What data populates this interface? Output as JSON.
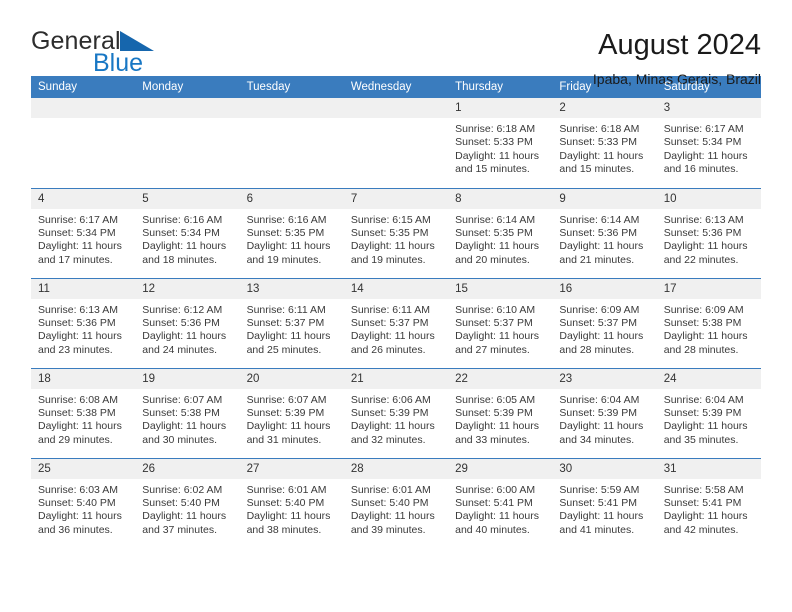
{
  "brand": {
    "name_part1": "General",
    "name_part2": "Blue",
    "accent_color": "#1877c4",
    "triangle_color": "#1666ad"
  },
  "header": {
    "title": "August 2024",
    "subtitle": "Ipaba, Minas Gerais, Brazil"
  },
  "calendar": {
    "header_bg": "#3a7cbe",
    "daynum_bg": "#f0f0f0",
    "weekday_labels": [
      "Sunday",
      "Monday",
      "Tuesday",
      "Wednesday",
      "Thursday",
      "Friday",
      "Saturday"
    ],
    "weeks": [
      [
        {
          "day": "",
          "empty": true
        },
        {
          "day": "",
          "empty": true
        },
        {
          "day": "",
          "empty": true
        },
        {
          "day": "",
          "empty": true
        },
        {
          "day": "1",
          "sunrise": "Sunrise: 6:18 AM",
          "sunset": "Sunset: 5:33 PM",
          "daylight_line1": "Daylight: 11 hours",
          "daylight_line2": "and 15 minutes."
        },
        {
          "day": "2",
          "sunrise": "Sunrise: 6:18 AM",
          "sunset": "Sunset: 5:33 PM",
          "daylight_line1": "Daylight: 11 hours",
          "daylight_line2": "and 15 minutes."
        },
        {
          "day": "3",
          "sunrise": "Sunrise: 6:17 AM",
          "sunset": "Sunset: 5:34 PM",
          "daylight_line1": "Daylight: 11 hours",
          "daylight_line2": "and 16 minutes."
        }
      ],
      [
        {
          "day": "4",
          "sunrise": "Sunrise: 6:17 AM",
          "sunset": "Sunset: 5:34 PM",
          "daylight_line1": "Daylight: 11 hours",
          "daylight_line2": "and 17 minutes."
        },
        {
          "day": "5",
          "sunrise": "Sunrise: 6:16 AM",
          "sunset": "Sunset: 5:34 PM",
          "daylight_line1": "Daylight: 11 hours",
          "daylight_line2": "and 18 minutes."
        },
        {
          "day": "6",
          "sunrise": "Sunrise: 6:16 AM",
          "sunset": "Sunset: 5:35 PM",
          "daylight_line1": "Daylight: 11 hours",
          "daylight_line2": "and 19 minutes."
        },
        {
          "day": "7",
          "sunrise": "Sunrise: 6:15 AM",
          "sunset": "Sunset: 5:35 PM",
          "daylight_line1": "Daylight: 11 hours",
          "daylight_line2": "and 19 minutes."
        },
        {
          "day": "8",
          "sunrise": "Sunrise: 6:14 AM",
          "sunset": "Sunset: 5:35 PM",
          "daylight_line1": "Daylight: 11 hours",
          "daylight_line2": "and 20 minutes."
        },
        {
          "day": "9",
          "sunrise": "Sunrise: 6:14 AM",
          "sunset": "Sunset: 5:36 PM",
          "daylight_line1": "Daylight: 11 hours",
          "daylight_line2": "and 21 minutes."
        },
        {
          "day": "10",
          "sunrise": "Sunrise: 6:13 AM",
          "sunset": "Sunset: 5:36 PM",
          "daylight_line1": "Daylight: 11 hours",
          "daylight_line2": "and 22 minutes."
        }
      ],
      [
        {
          "day": "11",
          "sunrise": "Sunrise: 6:13 AM",
          "sunset": "Sunset: 5:36 PM",
          "daylight_line1": "Daylight: 11 hours",
          "daylight_line2": "and 23 minutes."
        },
        {
          "day": "12",
          "sunrise": "Sunrise: 6:12 AM",
          "sunset": "Sunset: 5:36 PM",
          "daylight_line1": "Daylight: 11 hours",
          "daylight_line2": "and 24 minutes."
        },
        {
          "day": "13",
          "sunrise": "Sunrise: 6:11 AM",
          "sunset": "Sunset: 5:37 PM",
          "daylight_line1": "Daylight: 11 hours",
          "daylight_line2": "and 25 minutes."
        },
        {
          "day": "14",
          "sunrise": "Sunrise: 6:11 AM",
          "sunset": "Sunset: 5:37 PM",
          "daylight_line1": "Daylight: 11 hours",
          "daylight_line2": "and 26 minutes."
        },
        {
          "day": "15",
          "sunrise": "Sunrise: 6:10 AM",
          "sunset": "Sunset: 5:37 PM",
          "daylight_line1": "Daylight: 11 hours",
          "daylight_line2": "and 27 minutes."
        },
        {
          "day": "16",
          "sunrise": "Sunrise: 6:09 AM",
          "sunset": "Sunset: 5:37 PM",
          "daylight_line1": "Daylight: 11 hours",
          "daylight_line2": "and 28 minutes."
        },
        {
          "day": "17",
          "sunrise": "Sunrise: 6:09 AM",
          "sunset": "Sunset: 5:38 PM",
          "daylight_line1": "Daylight: 11 hours",
          "daylight_line2": "and 28 minutes."
        }
      ],
      [
        {
          "day": "18",
          "sunrise": "Sunrise: 6:08 AM",
          "sunset": "Sunset: 5:38 PM",
          "daylight_line1": "Daylight: 11 hours",
          "daylight_line2": "and 29 minutes."
        },
        {
          "day": "19",
          "sunrise": "Sunrise: 6:07 AM",
          "sunset": "Sunset: 5:38 PM",
          "daylight_line1": "Daylight: 11 hours",
          "daylight_line2": "and 30 minutes."
        },
        {
          "day": "20",
          "sunrise": "Sunrise: 6:07 AM",
          "sunset": "Sunset: 5:39 PM",
          "daylight_line1": "Daylight: 11 hours",
          "daylight_line2": "and 31 minutes."
        },
        {
          "day": "21",
          "sunrise": "Sunrise: 6:06 AM",
          "sunset": "Sunset: 5:39 PM",
          "daylight_line1": "Daylight: 11 hours",
          "daylight_line2": "and 32 minutes."
        },
        {
          "day": "22",
          "sunrise": "Sunrise: 6:05 AM",
          "sunset": "Sunset: 5:39 PM",
          "daylight_line1": "Daylight: 11 hours",
          "daylight_line2": "and 33 minutes."
        },
        {
          "day": "23",
          "sunrise": "Sunrise: 6:04 AM",
          "sunset": "Sunset: 5:39 PM",
          "daylight_line1": "Daylight: 11 hours",
          "daylight_line2": "and 34 minutes."
        },
        {
          "day": "24",
          "sunrise": "Sunrise: 6:04 AM",
          "sunset": "Sunset: 5:39 PM",
          "daylight_line1": "Daylight: 11 hours",
          "daylight_line2": "and 35 minutes."
        }
      ],
      [
        {
          "day": "25",
          "sunrise": "Sunrise: 6:03 AM",
          "sunset": "Sunset: 5:40 PM",
          "daylight_line1": "Daylight: 11 hours",
          "daylight_line2": "and 36 minutes."
        },
        {
          "day": "26",
          "sunrise": "Sunrise: 6:02 AM",
          "sunset": "Sunset: 5:40 PM",
          "daylight_line1": "Daylight: 11 hours",
          "daylight_line2": "and 37 minutes."
        },
        {
          "day": "27",
          "sunrise": "Sunrise: 6:01 AM",
          "sunset": "Sunset: 5:40 PM",
          "daylight_line1": "Daylight: 11 hours",
          "daylight_line2": "and 38 minutes."
        },
        {
          "day": "28",
          "sunrise": "Sunrise: 6:01 AM",
          "sunset": "Sunset: 5:40 PM",
          "daylight_line1": "Daylight: 11 hours",
          "daylight_line2": "and 39 minutes."
        },
        {
          "day": "29",
          "sunrise": "Sunrise: 6:00 AM",
          "sunset": "Sunset: 5:41 PM",
          "daylight_line1": "Daylight: 11 hours",
          "daylight_line2": "and 40 minutes."
        },
        {
          "day": "30",
          "sunrise": "Sunrise: 5:59 AM",
          "sunset": "Sunset: 5:41 PM",
          "daylight_line1": "Daylight: 11 hours",
          "daylight_line2": "and 41 minutes."
        },
        {
          "day": "31",
          "sunrise": "Sunrise: 5:58 AM",
          "sunset": "Sunset: 5:41 PM",
          "daylight_line1": "Daylight: 11 hours",
          "daylight_line2": "and 42 minutes."
        }
      ]
    ]
  }
}
